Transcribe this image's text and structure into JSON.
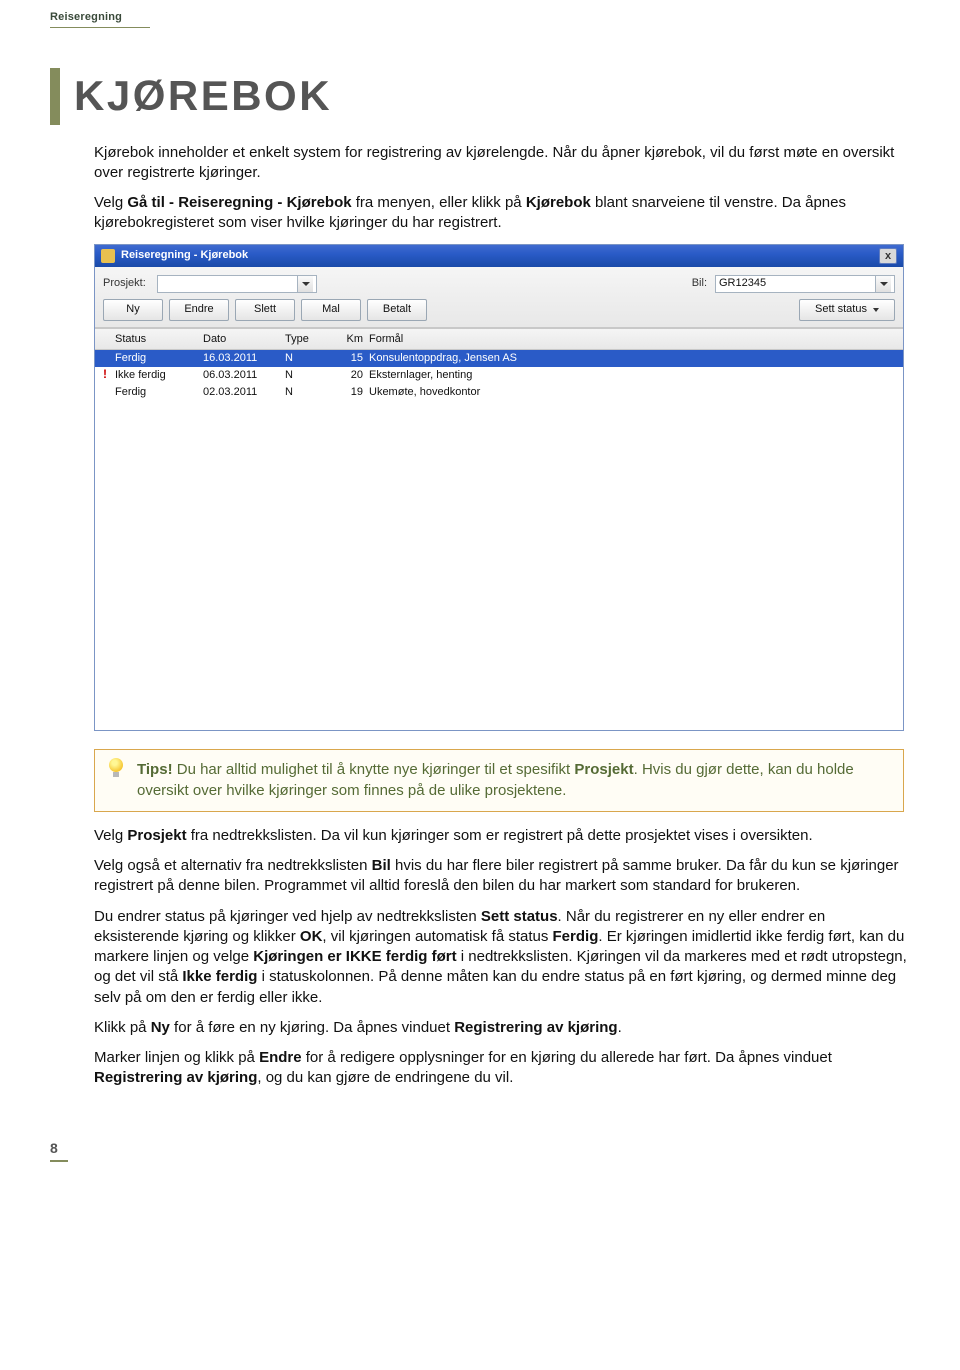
{
  "header": {
    "section": "Reiseregning"
  },
  "chapter": {
    "title": "KJØREBOK"
  },
  "intro": {
    "p1": "Kjørebok inneholder et enkelt system for registrering av kjørelengde. Når du åpner kjørebok, vil du først møte en oversikt over registrerte kjøringer.",
    "p2_pre": "Velg ",
    "p2_b1": "Gå til - Reiseregning - Kjørebok",
    "p2_mid": " fra menyen, eller klikk på ",
    "p2_b2": "Kjørebok",
    "p2_post": " blant snarveiene til venstre. Da åpnes kjørebokregisteret som viser hvilke kjøringer du har registrert."
  },
  "window": {
    "title": "Reiseregning - Kjørebok",
    "close": "x",
    "labels": {
      "prosjekt": "Prosjekt:",
      "bil": "Bil:"
    },
    "fields": {
      "prosjekt": "",
      "bil": "GR12345"
    },
    "buttons": {
      "ny": "Ny",
      "endre": "Endre",
      "slett": "Slett",
      "mal": "Mal",
      "betalt": "Betalt",
      "sett_status": "Sett status"
    },
    "columns": {
      "status": "Status",
      "dato": "Dato",
      "type": "Type",
      "km": "Km",
      "formal": "Formål"
    },
    "rows": [
      {
        "status": "Ferdig",
        "flag": "",
        "dato": "16.03.2011",
        "type": "N",
        "km": "15",
        "formal": "Konsulentoppdrag, Jensen AS",
        "selected": true
      },
      {
        "status": "Ikke ferdig",
        "flag": "!",
        "dato": "06.03.2011",
        "type": "N",
        "km": "20",
        "formal": "Eksternlager, henting",
        "selected": false
      },
      {
        "status": "Ferdig",
        "flag": "",
        "dato": "02.03.2011",
        "type": "N",
        "km": "19",
        "formal": "Ukemøte, hovedkontor",
        "selected": false
      }
    ]
  },
  "tips": {
    "lead": "Tips!",
    "t1": " Du har alltid mulighet til å knytte nye kjøringer til et spesifikt ",
    "b1": "Prosjekt",
    "t2": ". Hvis du gjør dette, kan du holde oversikt over hvilke kjøringer som finnes på de ulike prosjektene."
  },
  "post": {
    "p1_pre": "Velg ",
    "p1_b": "Prosjekt",
    "p1_post": " fra nedtrekkslisten. Da vil kun kjøringer som er registrert på dette prosjektet vises i oversikten.",
    "p2_pre": "Velg også et alternativ fra nedtrekkslisten ",
    "p2_b": "Bil",
    "p2_post": " hvis du har flere biler registrert på samme bruker. Da får du kun se kjøringer registrert på denne bilen. Programmet vil alltid foreslå den bilen du har markert som standard for brukeren.",
    "p3_pre": "Du endrer status på kjøringer ved hjelp av nedtrekkslisten ",
    "p3_b1": "Sett status",
    "p3_mid1": ". Når du registrerer en ny eller endrer en eksisterende kjøring og klikker ",
    "p3_b2": "OK",
    "p3_mid2": ", vil kjøringen automatisk få status ",
    "p3_b3": "Ferdig",
    "p3_mid3": ". Er kjøringen imidlertid ikke ferdig ført, kan du markere linjen og velge ",
    "p3_b4": "Kjøringen er IKKE ferdig ført",
    "p3_mid4": " i nedtrekkslisten. Kjøringen vil da markeres med et rødt utropstegn, og det vil stå ",
    "p3_b5": "Ikke ferdig",
    "p3_post": " i statuskolonnen. På denne måten kan du endre status på en ført kjøring, og dermed minne deg selv på om den er ferdig eller ikke.",
    "p4_pre": "Klikk på ",
    "p4_b1": "Ny",
    "p4_mid": " for å føre en ny kjøring. Da åpnes vinduet ",
    "p4_b2": "Registrering av kjøring",
    "p4_post": ".",
    "p5_pre": "Marker linjen og klikk på ",
    "p5_b1": "Endre",
    "p5_mid": " for å redigere opplysninger for en kjøring du allerede har ført. Da åpnes vinduet ",
    "p5_b2": "Registrering av kjøring",
    "p5_post": ", og du kan gjøre de endringene du vil."
  },
  "page": {
    "number": "8"
  }
}
